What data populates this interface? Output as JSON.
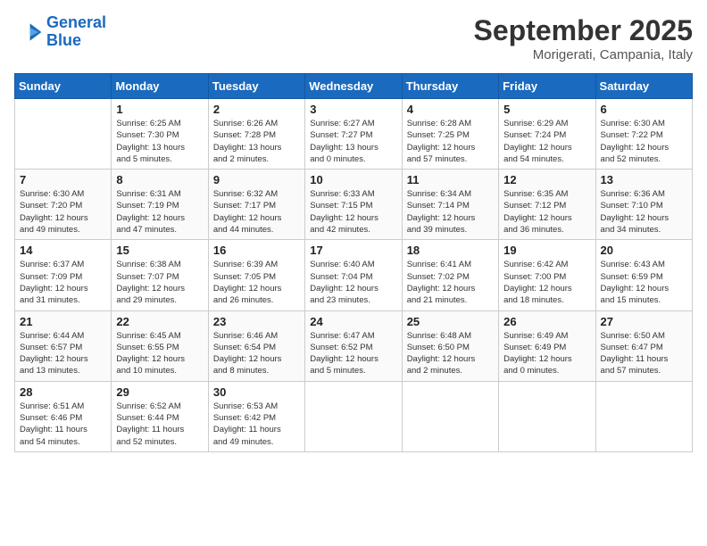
{
  "logo": {
    "line1": "General",
    "line2": "Blue"
  },
  "title": "September 2025",
  "location": "Morigerati, Campania, Italy",
  "days_of_week": [
    "Sunday",
    "Monday",
    "Tuesday",
    "Wednesday",
    "Thursday",
    "Friday",
    "Saturday"
  ],
  "weeks": [
    [
      {
        "day": "",
        "info": ""
      },
      {
        "day": "1",
        "info": "Sunrise: 6:25 AM\nSunset: 7:30 PM\nDaylight: 13 hours\nand 5 minutes."
      },
      {
        "day": "2",
        "info": "Sunrise: 6:26 AM\nSunset: 7:28 PM\nDaylight: 13 hours\nand 2 minutes."
      },
      {
        "day": "3",
        "info": "Sunrise: 6:27 AM\nSunset: 7:27 PM\nDaylight: 13 hours\nand 0 minutes."
      },
      {
        "day": "4",
        "info": "Sunrise: 6:28 AM\nSunset: 7:25 PM\nDaylight: 12 hours\nand 57 minutes."
      },
      {
        "day": "5",
        "info": "Sunrise: 6:29 AM\nSunset: 7:24 PM\nDaylight: 12 hours\nand 54 minutes."
      },
      {
        "day": "6",
        "info": "Sunrise: 6:30 AM\nSunset: 7:22 PM\nDaylight: 12 hours\nand 52 minutes."
      }
    ],
    [
      {
        "day": "7",
        "info": "Sunrise: 6:30 AM\nSunset: 7:20 PM\nDaylight: 12 hours\nand 49 minutes."
      },
      {
        "day": "8",
        "info": "Sunrise: 6:31 AM\nSunset: 7:19 PM\nDaylight: 12 hours\nand 47 minutes."
      },
      {
        "day": "9",
        "info": "Sunrise: 6:32 AM\nSunset: 7:17 PM\nDaylight: 12 hours\nand 44 minutes."
      },
      {
        "day": "10",
        "info": "Sunrise: 6:33 AM\nSunset: 7:15 PM\nDaylight: 12 hours\nand 42 minutes."
      },
      {
        "day": "11",
        "info": "Sunrise: 6:34 AM\nSunset: 7:14 PM\nDaylight: 12 hours\nand 39 minutes."
      },
      {
        "day": "12",
        "info": "Sunrise: 6:35 AM\nSunset: 7:12 PM\nDaylight: 12 hours\nand 36 minutes."
      },
      {
        "day": "13",
        "info": "Sunrise: 6:36 AM\nSunset: 7:10 PM\nDaylight: 12 hours\nand 34 minutes."
      }
    ],
    [
      {
        "day": "14",
        "info": "Sunrise: 6:37 AM\nSunset: 7:09 PM\nDaylight: 12 hours\nand 31 minutes."
      },
      {
        "day": "15",
        "info": "Sunrise: 6:38 AM\nSunset: 7:07 PM\nDaylight: 12 hours\nand 29 minutes."
      },
      {
        "day": "16",
        "info": "Sunrise: 6:39 AM\nSunset: 7:05 PM\nDaylight: 12 hours\nand 26 minutes."
      },
      {
        "day": "17",
        "info": "Sunrise: 6:40 AM\nSunset: 7:04 PM\nDaylight: 12 hours\nand 23 minutes."
      },
      {
        "day": "18",
        "info": "Sunrise: 6:41 AM\nSunset: 7:02 PM\nDaylight: 12 hours\nand 21 minutes."
      },
      {
        "day": "19",
        "info": "Sunrise: 6:42 AM\nSunset: 7:00 PM\nDaylight: 12 hours\nand 18 minutes."
      },
      {
        "day": "20",
        "info": "Sunrise: 6:43 AM\nSunset: 6:59 PM\nDaylight: 12 hours\nand 15 minutes."
      }
    ],
    [
      {
        "day": "21",
        "info": "Sunrise: 6:44 AM\nSunset: 6:57 PM\nDaylight: 12 hours\nand 13 minutes."
      },
      {
        "day": "22",
        "info": "Sunrise: 6:45 AM\nSunset: 6:55 PM\nDaylight: 12 hours\nand 10 minutes."
      },
      {
        "day": "23",
        "info": "Sunrise: 6:46 AM\nSunset: 6:54 PM\nDaylight: 12 hours\nand 8 minutes."
      },
      {
        "day": "24",
        "info": "Sunrise: 6:47 AM\nSunset: 6:52 PM\nDaylight: 12 hours\nand 5 minutes."
      },
      {
        "day": "25",
        "info": "Sunrise: 6:48 AM\nSunset: 6:50 PM\nDaylight: 12 hours\nand 2 minutes."
      },
      {
        "day": "26",
        "info": "Sunrise: 6:49 AM\nSunset: 6:49 PM\nDaylight: 12 hours\nand 0 minutes."
      },
      {
        "day": "27",
        "info": "Sunrise: 6:50 AM\nSunset: 6:47 PM\nDaylight: 11 hours\nand 57 minutes."
      }
    ],
    [
      {
        "day": "28",
        "info": "Sunrise: 6:51 AM\nSunset: 6:46 PM\nDaylight: 11 hours\nand 54 minutes."
      },
      {
        "day": "29",
        "info": "Sunrise: 6:52 AM\nSunset: 6:44 PM\nDaylight: 11 hours\nand 52 minutes."
      },
      {
        "day": "30",
        "info": "Sunrise: 6:53 AM\nSunset: 6:42 PM\nDaylight: 11 hours\nand 49 minutes."
      },
      {
        "day": "",
        "info": ""
      },
      {
        "day": "",
        "info": ""
      },
      {
        "day": "",
        "info": ""
      },
      {
        "day": "",
        "info": ""
      }
    ]
  ]
}
